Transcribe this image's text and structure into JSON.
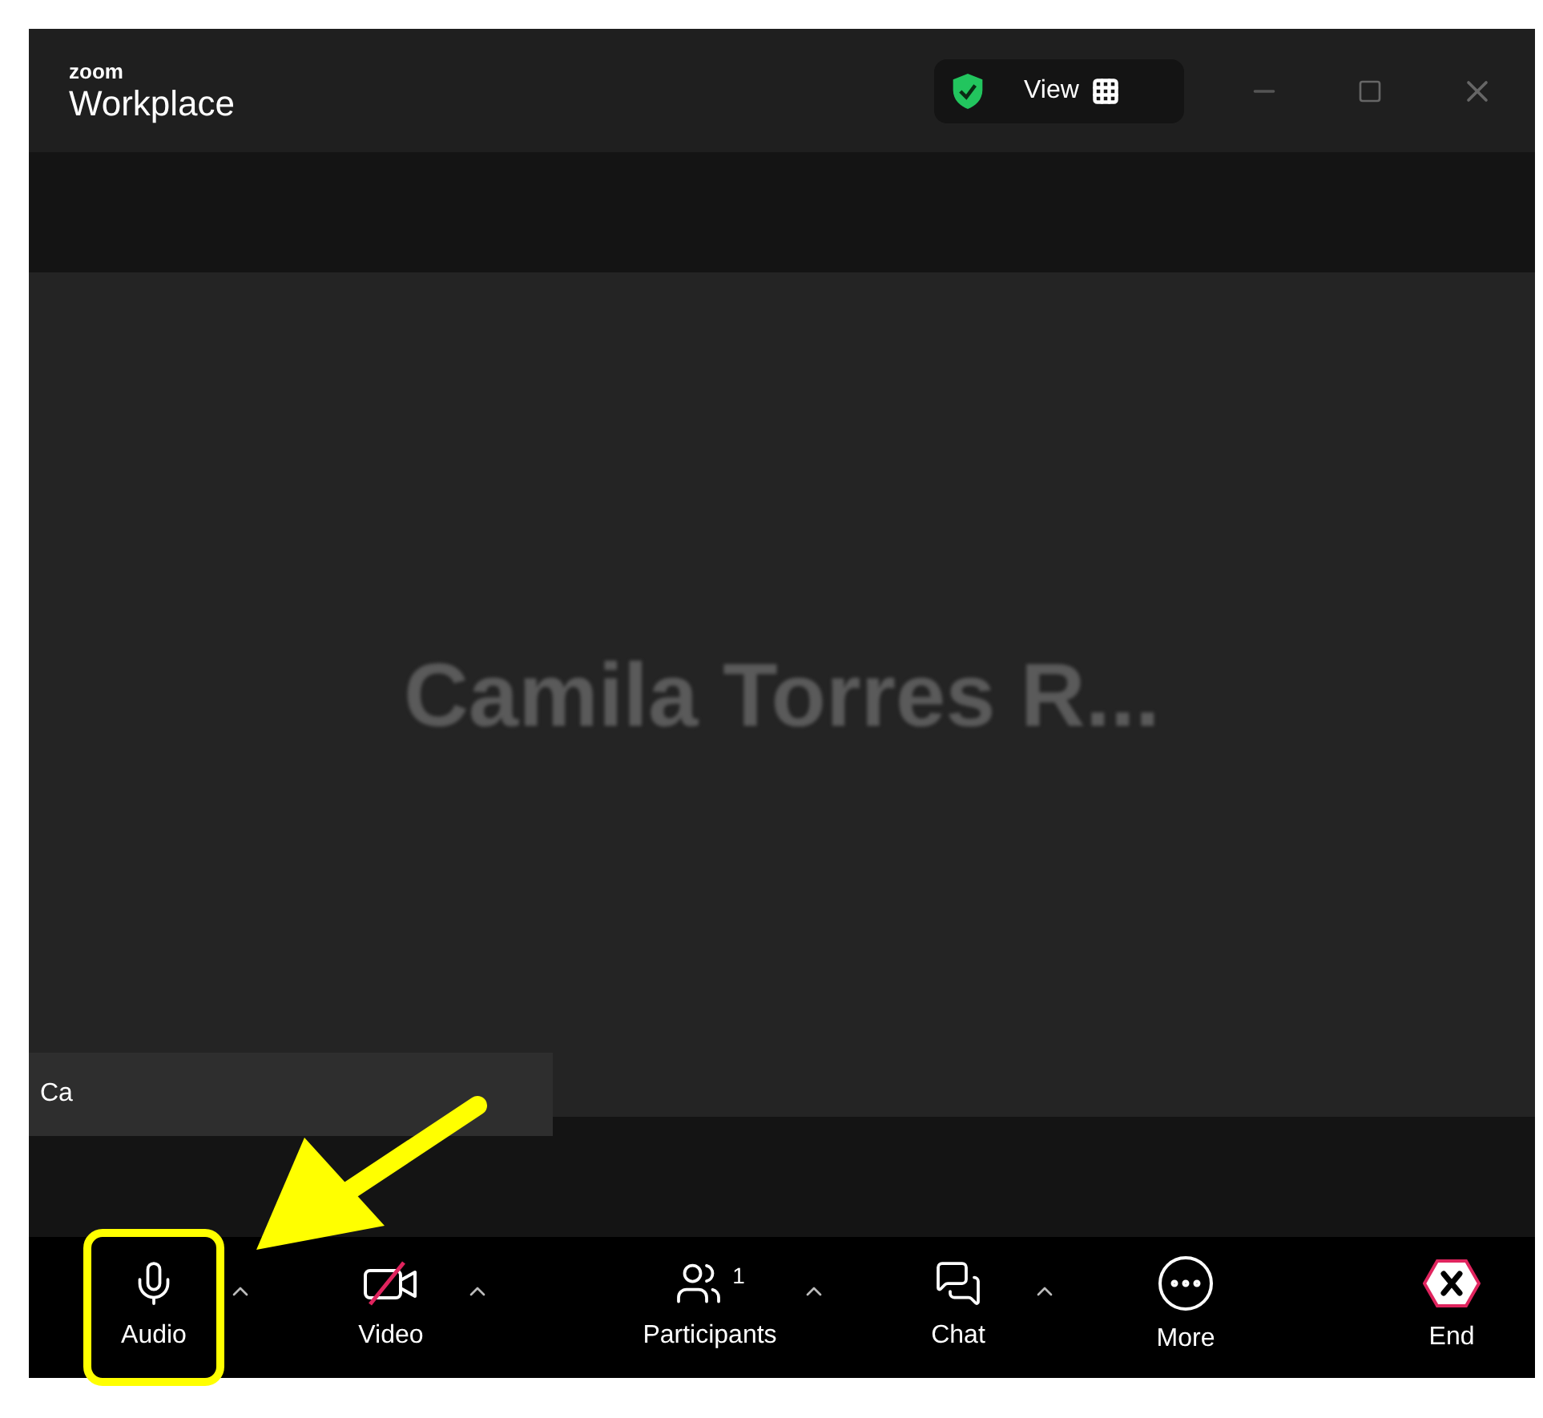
{
  "window": {
    "brand_small": "zoom",
    "brand": "Workplace",
    "view_button": {
      "label": "View"
    },
    "secure": true
  },
  "video": {
    "participant_name": "Camila Torres R...",
    "name_tag": "Ca"
  },
  "toolbar": [
    {
      "kind": "audio",
      "label": "Audio",
      "menu": true,
      "highlighted": true
    },
    {
      "kind": "video",
      "label": "Video",
      "menu": true,
      "highlighted": false,
      "off": true
    },
    {
      "kind": "participants",
      "label": "Participants",
      "count": "1",
      "menu": true,
      "highlighted": false
    },
    {
      "kind": "chat",
      "label": "Chat",
      "menu": true,
      "highlighted": false
    },
    {
      "kind": "more",
      "label": "More",
      "menu": false,
      "highlighted": false
    },
    {
      "kind": "end",
      "label": "End",
      "menu": false,
      "highlighted": false
    }
  ]
}
